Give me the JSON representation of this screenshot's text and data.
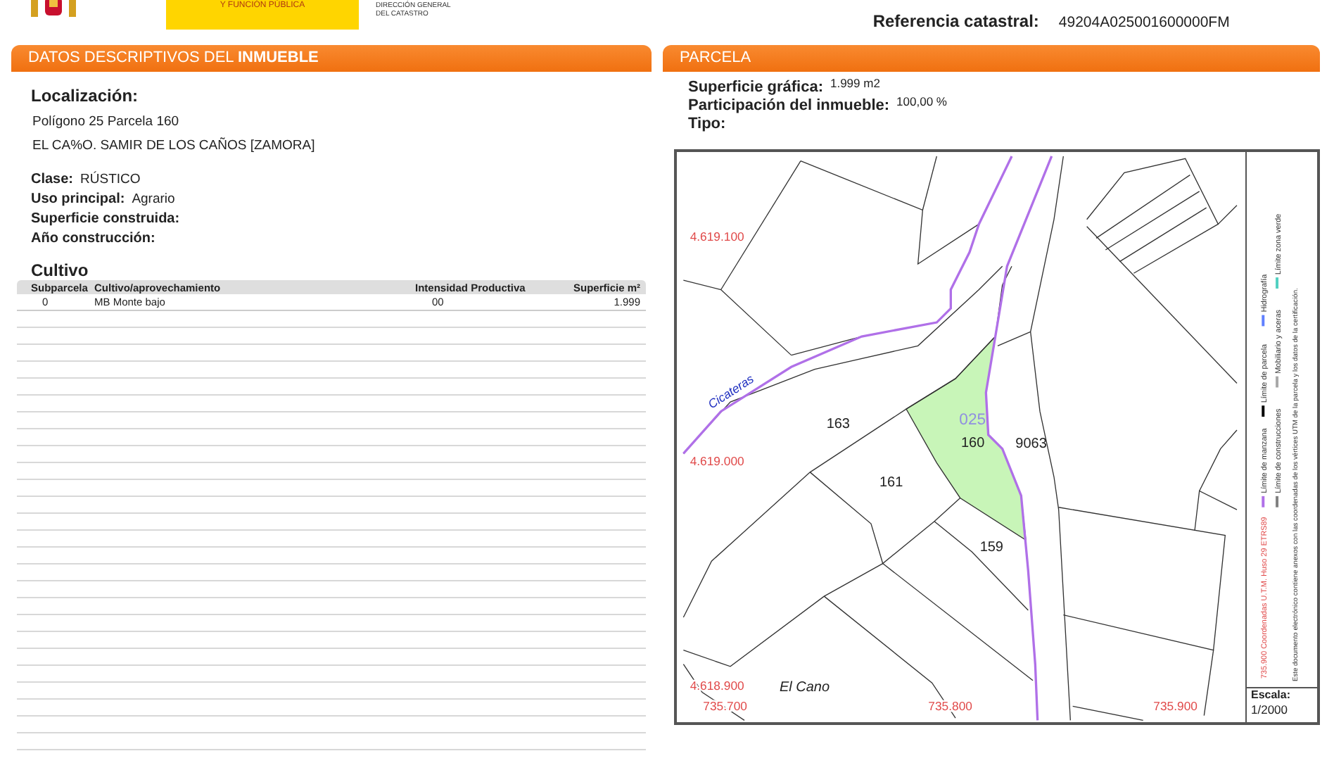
{
  "header": {
    "ministry": "Y FUNCIÓN PÚBLICA",
    "agency": [
      "DIRECCIÓN GENERAL",
      "DEL CATASTRO"
    ],
    "reference": {
      "label": "Referencia catastral:",
      "value": "49204A025001600000FM"
    }
  },
  "left": {
    "title": "DATOS DESCRIPTIVOS DEL **INMUEBLE**",
    "location": {
      "label": "Localización:",
      "lines": [
        "Polígono 25 Parcela 160",
        "EL CA%O. SAMIR DE LOS CAÑOS [ZAMORA]"
      ]
    },
    "fields": [
      {
        "label": "Clase:",
        "value": "RÚSTICO"
      },
      {
        "label": "Uso principal:",
        "value": "Agrario"
      },
      {
        "label": "Superficie construida:"
      },
      {
        "label": "Año construcción:"
      }
    ],
    "cultivo": {
      "title": "Cultivo",
      "columns": [
        "Subparcela",
        "Cultivo/aprovechamiento",
        "Intensidad Productiva",
        "Superficie m²"
      ],
      "rows": [
        [
          "0",
          "MB Monte bajo",
          "00",
          "1.999"
        ]
      ]
    }
  },
  "right": {
    "title": "PARCELA",
    "fields": [
      {
        "label": "Superficie gráfica:",
        "value": "1.999 m2"
      },
      {
        "label": "Participación del inmueble:",
        "value": "100,00 %"
      },
      {
        "label": "Tipo:"
      }
    ],
    "map": {
      "labels": [
        {
          "text": "4.619.100",
          "kind": "coord"
        },
        {
          "text": "4.619.000",
          "kind": "coord"
        },
        {
          "text": "4.618.900",
          "kind": "coord"
        },
        {
          "text": "735.700",
          "kind": "coord"
        },
        {
          "text": "735.800",
          "kind": "coord"
        },
        {
          "text": "735.900",
          "kind": "coord"
        },
        {
          "text": "Cicateras",
          "kind": "stream"
        },
        {
          "text": "163",
          "kind": "parcel"
        },
        {
          "text": "025",
          "kind": "polygon"
        },
        {
          "text": "160",
          "kind": "parcel"
        },
        {
          "text": "9063",
          "kind": "parcel"
        },
        {
          "text": "161",
          "kind": "parcel"
        },
        {
          "text": "159",
          "kind": "parcel"
        },
        {
          "text": "El Cano",
          "kind": "place"
        }
      ]
    },
    "legend": [
      [
        {
          "label": "Límite de manzana",
          "color": "#b070e8"
        },
        {
          "label": "Límite de parcela",
          "color": "#000000"
        },
        {
          "label": "Hidrografía",
          "color": "#6080ff"
        }
      ],
      [
        {
          "label": "Límite de construcciones",
          "color": "#808080"
        },
        {
          "label": "Mobiliario y aceras",
          "color": "#a8a8a8"
        },
        {
          "label": "Límite zona verde",
          "color": "#50d0c0"
        }
      ]
    ],
    "coordinates_note": "735.900 Coordenadas U.T.M. Huso 29 ETRS89",
    "document_note": "Este documento electrónico contiene anexos con las coordenadas de los vértices UTM de la parcela y los datos de la certificación.",
    "scale": {
      "label": "Escala:",
      "value": "1/2000"
    }
  }
}
